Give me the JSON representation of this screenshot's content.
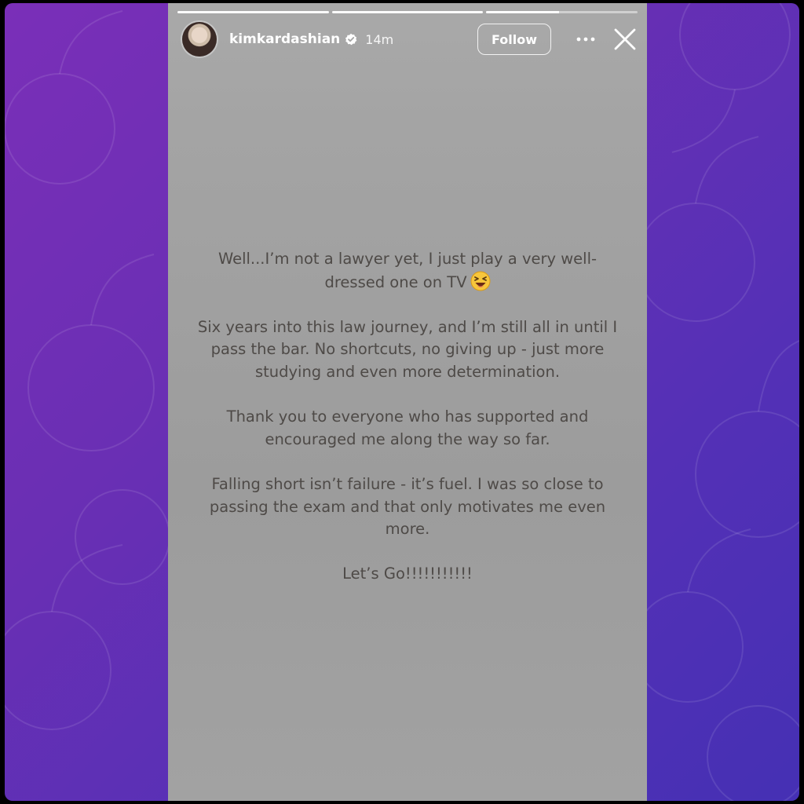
{
  "story": {
    "username": "kimkardashian",
    "verified_icon": "verified-badge-icon",
    "time_ago": "14m",
    "follow_label": "Follow",
    "more_icon": "more-horizontal-icon",
    "close_icon": "close-icon",
    "progress": {
      "segments_total": 3,
      "segments_completed": 2,
      "current_segment_fill": 0.48
    },
    "message": {
      "paragraph_1_text": "Well...I’m not a lawyer yet, I just play a very well-dressed one on TV",
      "paragraph_1_emoji": "😆",
      "paragraph_2": "Six years into this law journey, and I’m still all in until I pass the bar. No shortcuts, no giving up - just more studying and even more determination.",
      "paragraph_3": "Thank you to everyone who has supported and encouraged me along the way so far.",
      "paragraph_4": "Falling short isn’t failure - it’s fuel. I was so close to passing the exam and that only motivates me even more.",
      "paragraph_5": "Let’s Go!!!!!!!!!!!"
    }
  },
  "colors": {
    "background_gradient_start": "#7a2fb8",
    "background_gradient_end": "#4530b4",
    "story_background": "#a4a4a4",
    "message_text": "#4e4a47"
  }
}
